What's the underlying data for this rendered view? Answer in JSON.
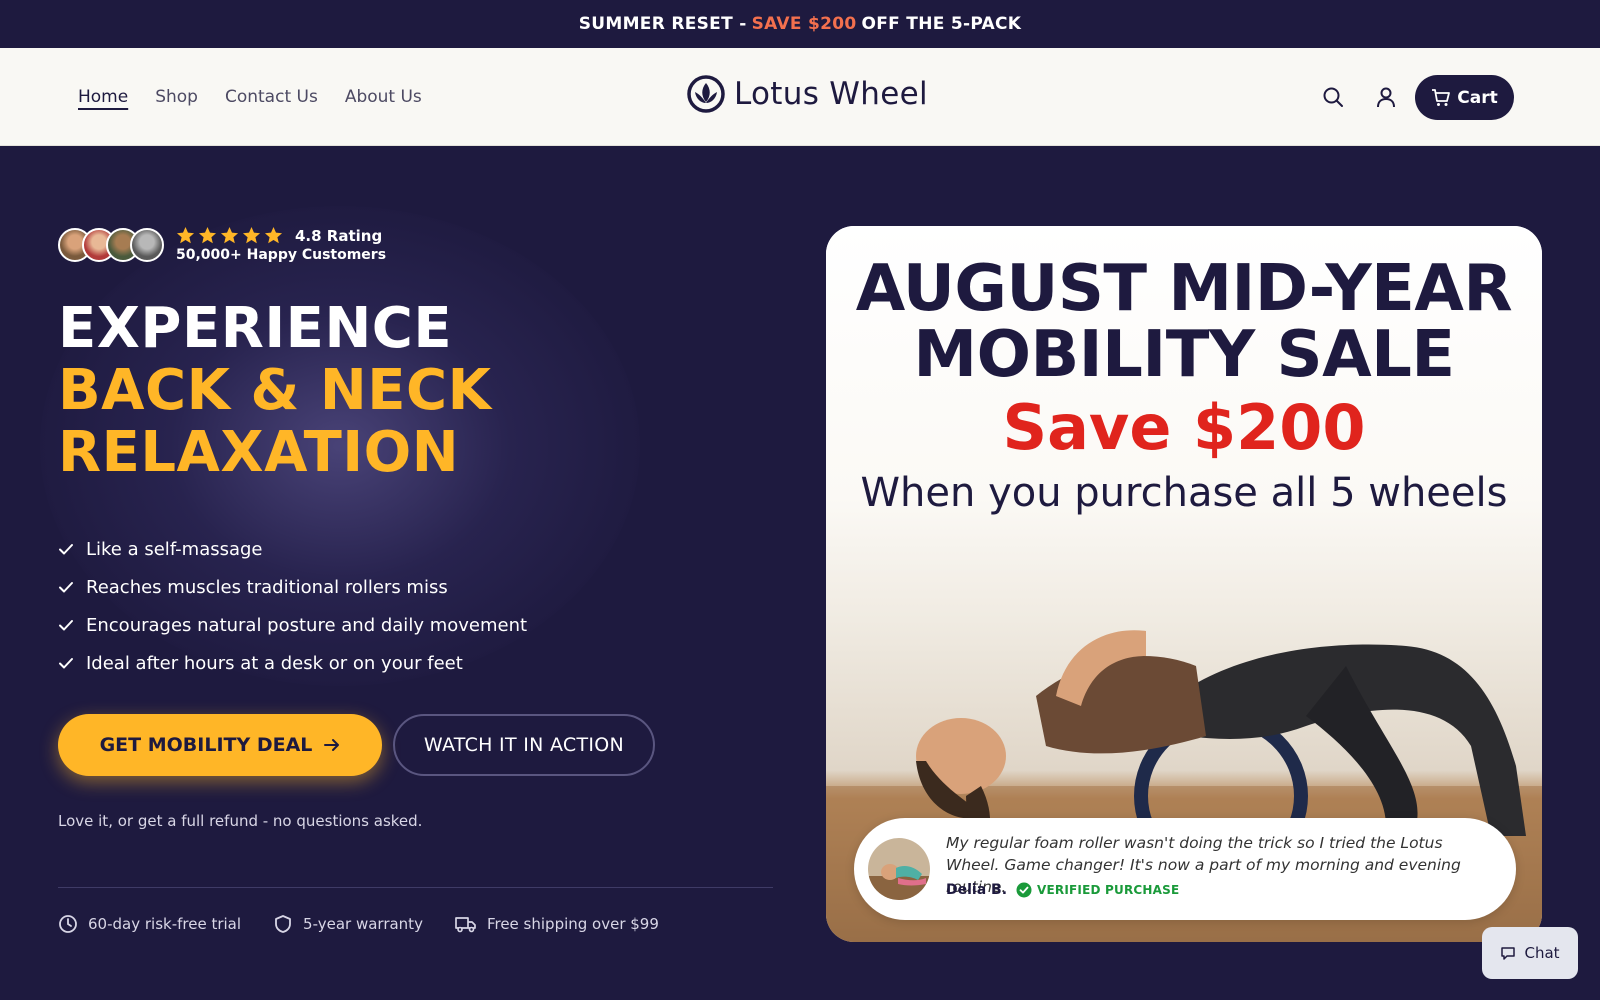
{
  "announcement": {
    "prefix": "SUMMER RESET -",
    "highlight": "SAVE $200",
    "suffix": "OFF THE 5-PACK",
    "highlight_color": "#f3704e"
  },
  "header": {
    "nav": [
      "Home",
      "Shop",
      "Contact Us",
      "About Us"
    ],
    "active_nav": "Home",
    "logo_text": "Lotus Wheel",
    "icons": [
      "search-icon",
      "account-icon",
      "cart-icon"
    ],
    "cart_label": "Cart"
  },
  "hero": {
    "rating": {
      "stars": 5,
      "value": "4.8 Rating",
      "customers": "50,000+ Happy Customers"
    },
    "headline": {
      "line1": "EXPERIENCE",
      "line2": "BACK & NECK",
      "line3": "RELAXATION"
    },
    "features": [
      "Like a self-massage",
      "Reaches muscles traditional rollers miss",
      "Encourages natural posture and daily movement",
      "Ideal after hours at a desk or on your feet"
    ],
    "primary_cta": "GET MOBILITY DEAL",
    "secondary_cta": "WATCH IT IN ACTION",
    "guarantee": "Love it, or get a full refund - no questions asked.",
    "trust": [
      "60-day risk-free trial",
      "5-year warranty",
      "Free shipping over $99"
    ]
  },
  "promo": {
    "title_line1": "AUGUST MID-YEAR",
    "title_line2": "MOBILITY SALE",
    "save": "Save $200",
    "subtitle": "When you purchase all 5 wheels",
    "review": {
      "text": "My regular foam roller wasn't doing the trick so I tried the Lotus Wheel. Game changer! It's now a part of my morning and evening routine.",
      "author": "Delia B.",
      "badge": "VERIFIED PURCHASE"
    }
  },
  "chat": {
    "label": "Chat"
  },
  "colors": {
    "navy": "#1e1a3f",
    "accent_yellow": "#ffb627",
    "sale_red": "#e0241d",
    "verified_green": "#1a9a3a"
  }
}
